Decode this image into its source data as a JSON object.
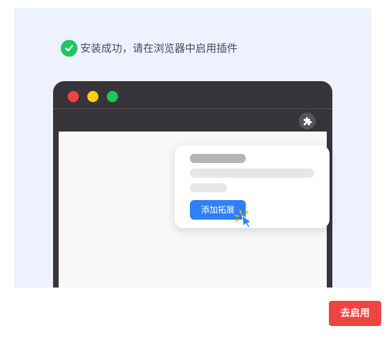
{
  "header": {
    "status_icon": "check-circle-icon",
    "status_text": "安装成功，请在浏览器中启用插件"
  },
  "illustration": {
    "window_controls": [
      "close",
      "minimize",
      "maximize"
    ],
    "extension_icon": "puzzle-piece-icon",
    "popup": {
      "add_button_label": "添加拓展",
      "cursor_icon": "pointer-cursor-icon"
    }
  },
  "footer": {
    "enable_button_label": "去启用"
  },
  "colors": {
    "success": "#22c55e",
    "primary_blue": "#2f80f7",
    "danger_red": "#ef4444",
    "hero_background": "#eef2ff",
    "browser_frame": "#37343a"
  }
}
